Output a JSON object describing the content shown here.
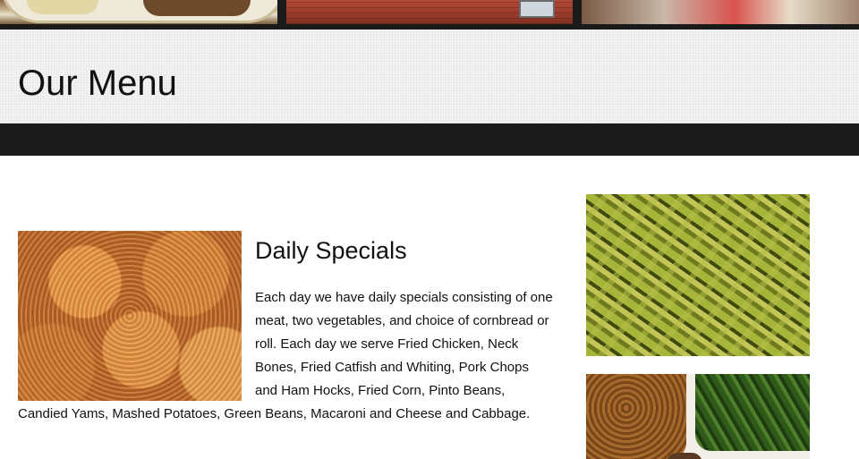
{
  "header": {
    "banner_photos": [
      "food-plate-photo",
      "brick-building-photo",
      "diners-table-photo"
    ],
    "page_title": "Our Menu"
  },
  "main": {
    "section_title": "Daily Specials",
    "description": "Each day we have daily specials consisting of one meat, two vegetables, and choice of cornbread or roll. Each day we serve Fried Chicken, Neck Bones, Fried Catfish and Whiting, Pork Chops and Ham Hocks, Fried Corn, Pinto Beans, Candied Yams, Mashed Potatoes, Green Beans, Macaroni and Cheese and Cabbage.",
    "main_image": "fried-chicken-photo"
  },
  "sidebar": {
    "images": [
      "green-beans-photo",
      "pinto-beans-and-greens-photo"
    ]
  },
  "colors": {
    "dark_bar": "#1b1b1b",
    "title_band": "#f4f4f4",
    "text": "#111111"
  }
}
